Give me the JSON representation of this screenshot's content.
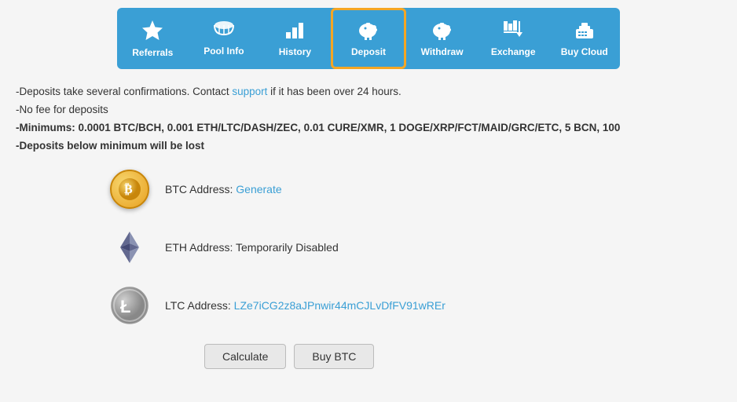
{
  "nav": {
    "items": [
      {
        "id": "referrals",
        "label": "Referrals",
        "icon": "⭐",
        "active": false
      },
      {
        "id": "pool-info",
        "label": "Pool Info",
        "icon": "☁",
        "active": false
      },
      {
        "id": "history",
        "label": "History",
        "icon": "📊",
        "active": false
      },
      {
        "id": "deposit",
        "label": "Deposit",
        "icon": "🐷",
        "active": true
      },
      {
        "id": "withdraw",
        "label": "Withdraw",
        "icon": "🐷",
        "active": false
      },
      {
        "id": "exchange",
        "label": "Exchange",
        "icon": "💰",
        "active": false
      },
      {
        "id": "buy-cloud",
        "label": "Buy Cloud",
        "icon": "💻",
        "active": false
      }
    ]
  },
  "info": {
    "line1_prefix": "-Deposits take several confirmations. Contact ",
    "line1_link": "support",
    "line1_suffix": " if it has been over 24 hours.",
    "line2": "-No fee for deposits",
    "line3": "-Minimums: 0.0001 BTC/BCH, 0.001 ETH/LTC/DASH/ZEC, 0.01 CURE/XMR, 1 DOGE/XRP/FCT/MAID/GRC/ETC, 5 BCN, 100",
    "line4": "-Deposits below minimum will be lost"
  },
  "coins": [
    {
      "id": "btc",
      "name": "BTC",
      "label": "BTC Address: ",
      "value": "Generate",
      "value_type": "link",
      "icon_type": "btc"
    },
    {
      "id": "eth",
      "name": "ETH",
      "label": "ETH Address: ",
      "value": "Temporarily Disabled",
      "value_type": "text",
      "icon_type": "eth"
    },
    {
      "id": "ltc",
      "name": "LTC",
      "label": "LTC Address: ",
      "value": "LZe7iCG2z8aJPnwir44mCJLvDfFV91wREr",
      "value_type": "link",
      "icon_type": "ltc"
    }
  ],
  "buttons": {
    "calculate": "Calculate",
    "buy_btc": "Buy BTC"
  },
  "colors": {
    "nav_bg": "#3a9fd5",
    "active_border": "#f5a623",
    "link": "#3a9fd5"
  }
}
